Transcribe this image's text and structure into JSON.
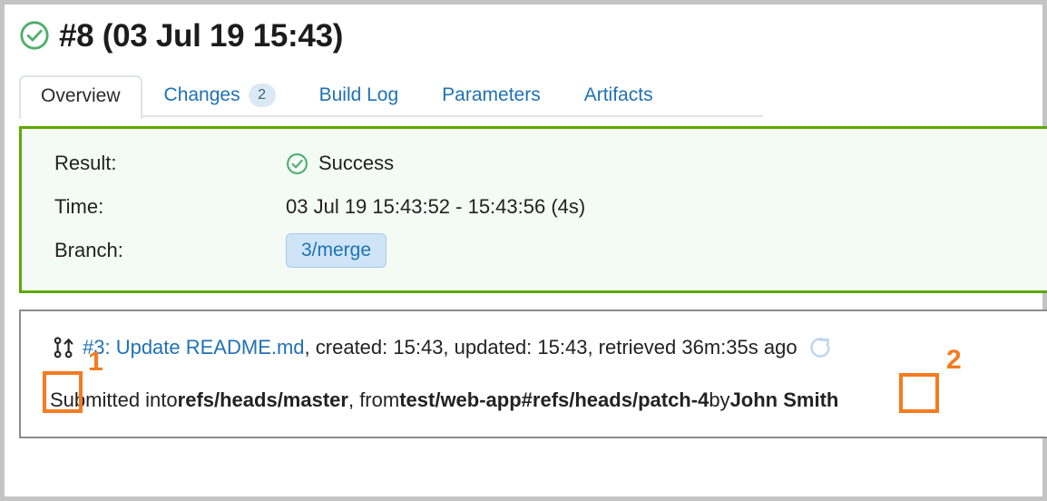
{
  "header": {
    "status_icon": "check-circle-icon",
    "title": "#8 (03 Jul 19 15:43)"
  },
  "tabs": [
    {
      "label": "Overview",
      "active": true,
      "badge": null
    },
    {
      "label": "Changes",
      "active": false,
      "badge": "2"
    },
    {
      "label": "Build Log",
      "active": false,
      "badge": null
    },
    {
      "label": "Parameters",
      "active": false,
      "badge": null
    },
    {
      "label": "Artifacts",
      "active": false,
      "badge": null
    }
  ],
  "result_panel": {
    "rows": {
      "result_label": "Result:",
      "result_value": "Success",
      "result_icon": "check-circle-icon",
      "time_label": "Time:",
      "time_value": "03 Jul 19 15:43:52 - 15:43:56 (4s)",
      "branch_label": "Branch:",
      "branch_value": "3/merge"
    }
  },
  "pull_request": {
    "icon": "pull-request-icon",
    "link_text": "#3: Update README.md",
    "meta_text": ", created: 15:43, updated: 15:43, retrieved 36m:35s ago",
    "refresh_icon": "refresh-icon",
    "submitted_prefix": "Submitted into ",
    "target_branch": "refs/heads/master",
    "from_separator": ", from ",
    "source_branch": "test/web-app#refs/heads/patch-4",
    "by_separator": " by ",
    "author": "John Smith"
  },
  "annotations": [
    {
      "number": "1",
      "target": "pull-request-icon"
    },
    {
      "number": "2",
      "target": "refresh-icon"
    }
  ],
  "colors": {
    "success_green": "#5ca904",
    "link_blue": "#2071b5",
    "annotation_orange": "#f47b20",
    "panel_green_bg": "#f4faf4",
    "badge_blue_bg": "#cfe5f7"
  }
}
